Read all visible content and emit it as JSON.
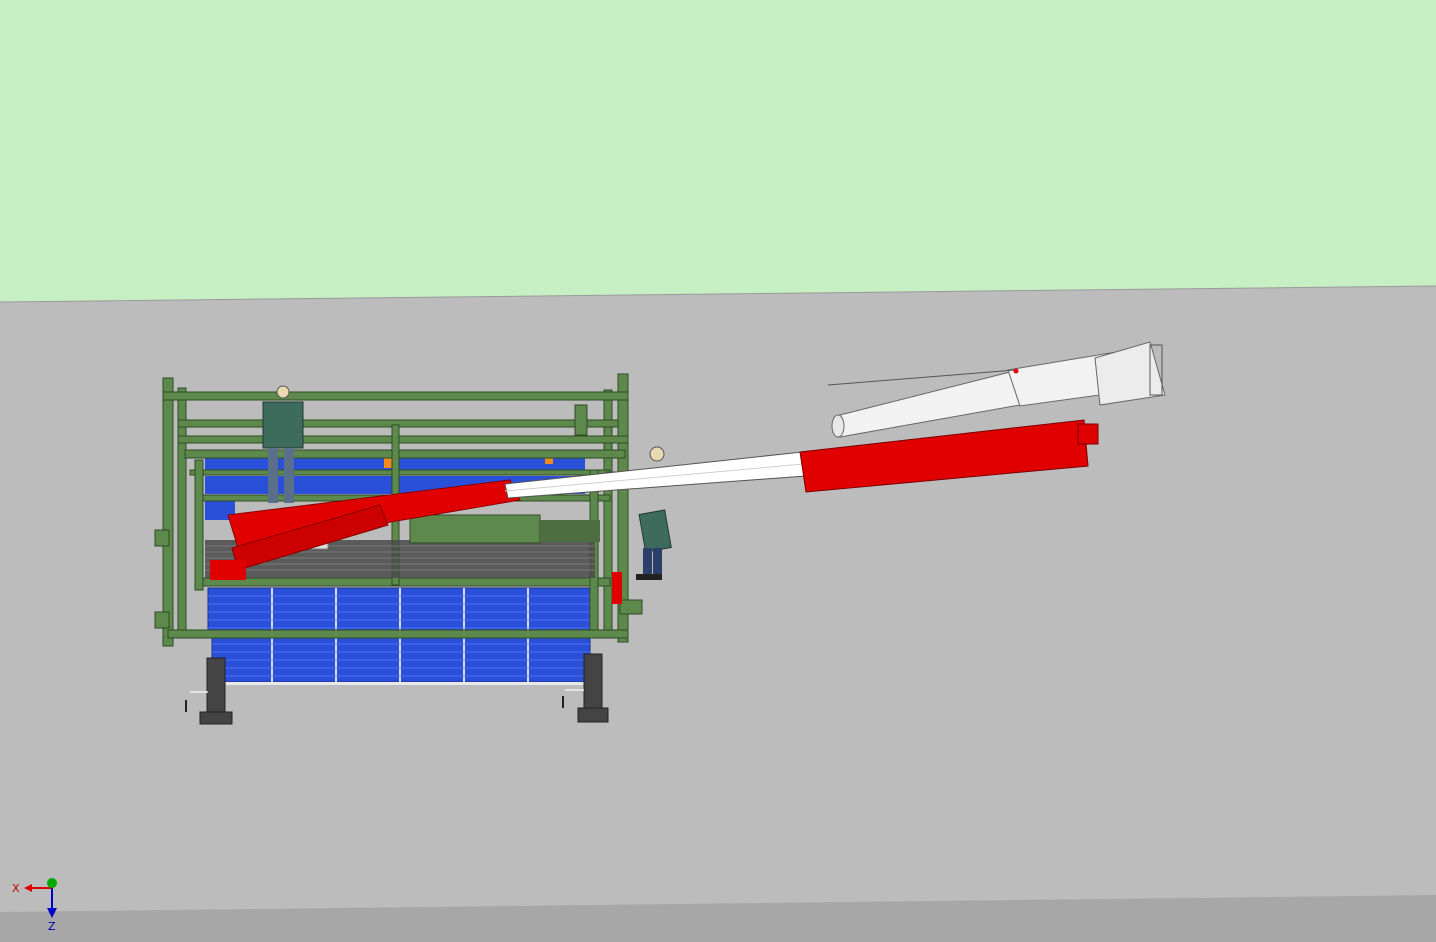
{
  "viewport": {
    "sky_color": "#c6f0c4",
    "ground_color": "#bcbcbc",
    "floor_edge_color": "#a7a7a7"
  },
  "model": {
    "frame_color": "#5d8a4c",
    "solar_panel_color": "#2a4fd8",
    "boom_color": "#e10000",
    "boom_tip_color": "#ffffff",
    "payload_color": "#f2f2f2",
    "tower_color": "#444444",
    "figure_color": "#3d6b5c"
  },
  "axis_triad": {
    "x_label": "X",
    "z_label": "Z",
    "x_color": "#e00000",
    "y_color": "#00aa00",
    "z_color": "#0000cc"
  }
}
